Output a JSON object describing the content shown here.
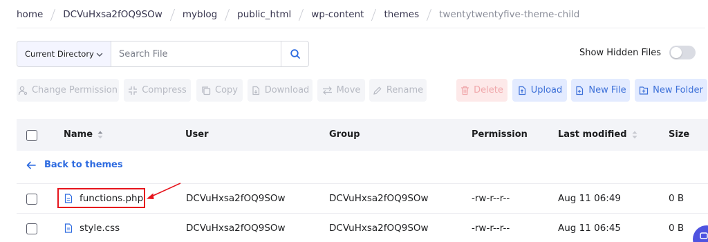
{
  "breadcrumb": [
    "home",
    "DCVuHxsa2fOQ9SOw",
    "myblog",
    "public_html",
    "wp-content",
    "themes",
    "twentytwentyfive-theme-child"
  ],
  "search": {
    "scope_label": "Current Directory",
    "placeholder": "Search File"
  },
  "show_hidden_label": "Show Hidden Files",
  "toolbar": {
    "change_permission": "Change Permission",
    "compress": "Compress",
    "copy": "Copy",
    "download": "Download",
    "move": "Move",
    "rename": "Rename",
    "delete": "Delete",
    "upload": "Upload",
    "new_file": "New File",
    "new_folder": "New Folder"
  },
  "table": {
    "headers": {
      "name": "Name",
      "user": "User",
      "group": "Group",
      "permission": "Permission",
      "last_modified": "Last modified",
      "size": "Size"
    },
    "back_label": "Back to themes",
    "rows": [
      {
        "name": "functions.php",
        "user": "DCVuHxsa2fOQ9SOw",
        "group": "DCVuHxsa2fOQ9SOw",
        "permission": "-rw-r--r--",
        "modified": "Aug 11 06:49",
        "size": "0 B"
      },
      {
        "name": "style.css",
        "user": "DCVuHxsa2fOQ9SOw",
        "group": "DCVuHxsa2fOQ9SOw",
        "permission": "-rw-r--r--",
        "modified": "Aug 11 06:45",
        "size": "0 B"
      }
    ]
  },
  "colors": {
    "accent": "#2c6ae0",
    "highlight": "#e6141c",
    "corner_button": "#4f53e0"
  }
}
